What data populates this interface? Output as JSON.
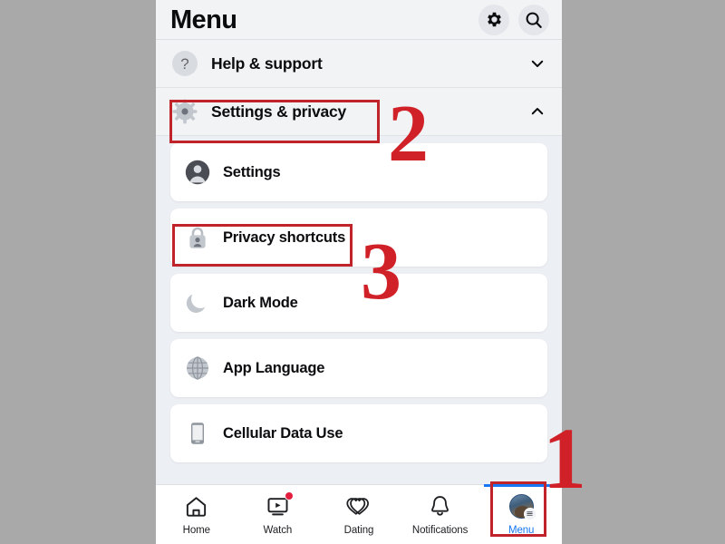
{
  "header": {
    "title": "Menu",
    "actions": [
      {
        "name": "gear-icon",
        "label": "Settings"
      },
      {
        "name": "search-icon",
        "label": "Search"
      }
    ]
  },
  "groups": [
    {
      "label": "Help & support",
      "icon": "question-circle-icon",
      "expanded": false,
      "chevron": "chevron-down-icon"
    },
    {
      "label": "Settings & privacy",
      "icon": "gear-icon",
      "expanded": true,
      "chevron": "chevron-up-icon"
    }
  ],
  "items": [
    {
      "label": "Settings",
      "icon": "person-circle-icon"
    },
    {
      "label": "Privacy shortcuts",
      "icon": "lock-person-icon"
    },
    {
      "label": "Dark Mode",
      "icon": "moon-icon"
    },
    {
      "label": "App Language",
      "icon": "globe-icon"
    },
    {
      "label": "Cellular Data Use",
      "icon": "mobile-phone-icon"
    }
  ],
  "bottom_nav": {
    "items": [
      {
        "label": "Home",
        "icon": "home-icon",
        "active": false,
        "badge": false
      },
      {
        "label": "Watch",
        "icon": "watch-play-icon",
        "active": false,
        "badge": true
      },
      {
        "label": "Dating",
        "icon": "dating-hearts-icon",
        "active": false,
        "badge": false
      },
      {
        "label": "Notifications",
        "icon": "bell-icon",
        "active": false,
        "badge": false
      },
      {
        "label": "Menu",
        "icon": "avatar-menu-icon",
        "active": true,
        "badge": false
      }
    ]
  },
  "annotations": {
    "step_1": "1",
    "step_2": "2",
    "step_3": "3",
    "highlight_color": "#c0232a",
    "numeral_color": "#d12128",
    "active_tab_color": "#1877f2"
  }
}
